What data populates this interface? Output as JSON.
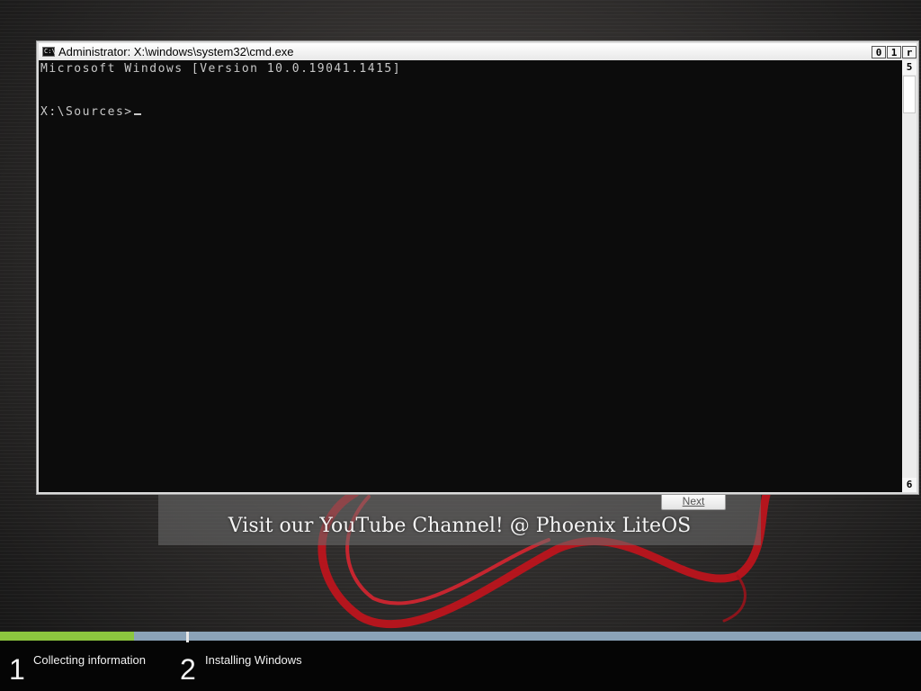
{
  "window": {
    "title": "Administrator: X:\\windows\\system32\\cmd.exe",
    "icon": "cmd-icon",
    "caption_buttons": {
      "minimize": "0",
      "maximize": "1",
      "close": "r"
    }
  },
  "console": {
    "lines": [
      "Microsoft Windows [Version 10.0.19041.1415]",
      "X:\\Sources>"
    ]
  },
  "scrollbar": {
    "up_arrow": "5",
    "down_arrow": "6"
  },
  "setup": {
    "next_label": "Next",
    "promo": "Visit our YouTube Channel! @ Phoenix LiteOS"
  },
  "progress": {
    "steps": [
      {
        "number": "1",
        "label": "Collecting information",
        "fill_fraction": 0.72
      },
      {
        "number": "2",
        "label": "Installing Windows",
        "fill_fraction": 0
      }
    ],
    "fill_color": "#8cc63f",
    "track_color": "#8ba3b8"
  },
  "colors": {
    "console_bg": "#0c0c0c",
    "console_fg": "#c8c8c8",
    "ribbon": "#c0141c"
  }
}
